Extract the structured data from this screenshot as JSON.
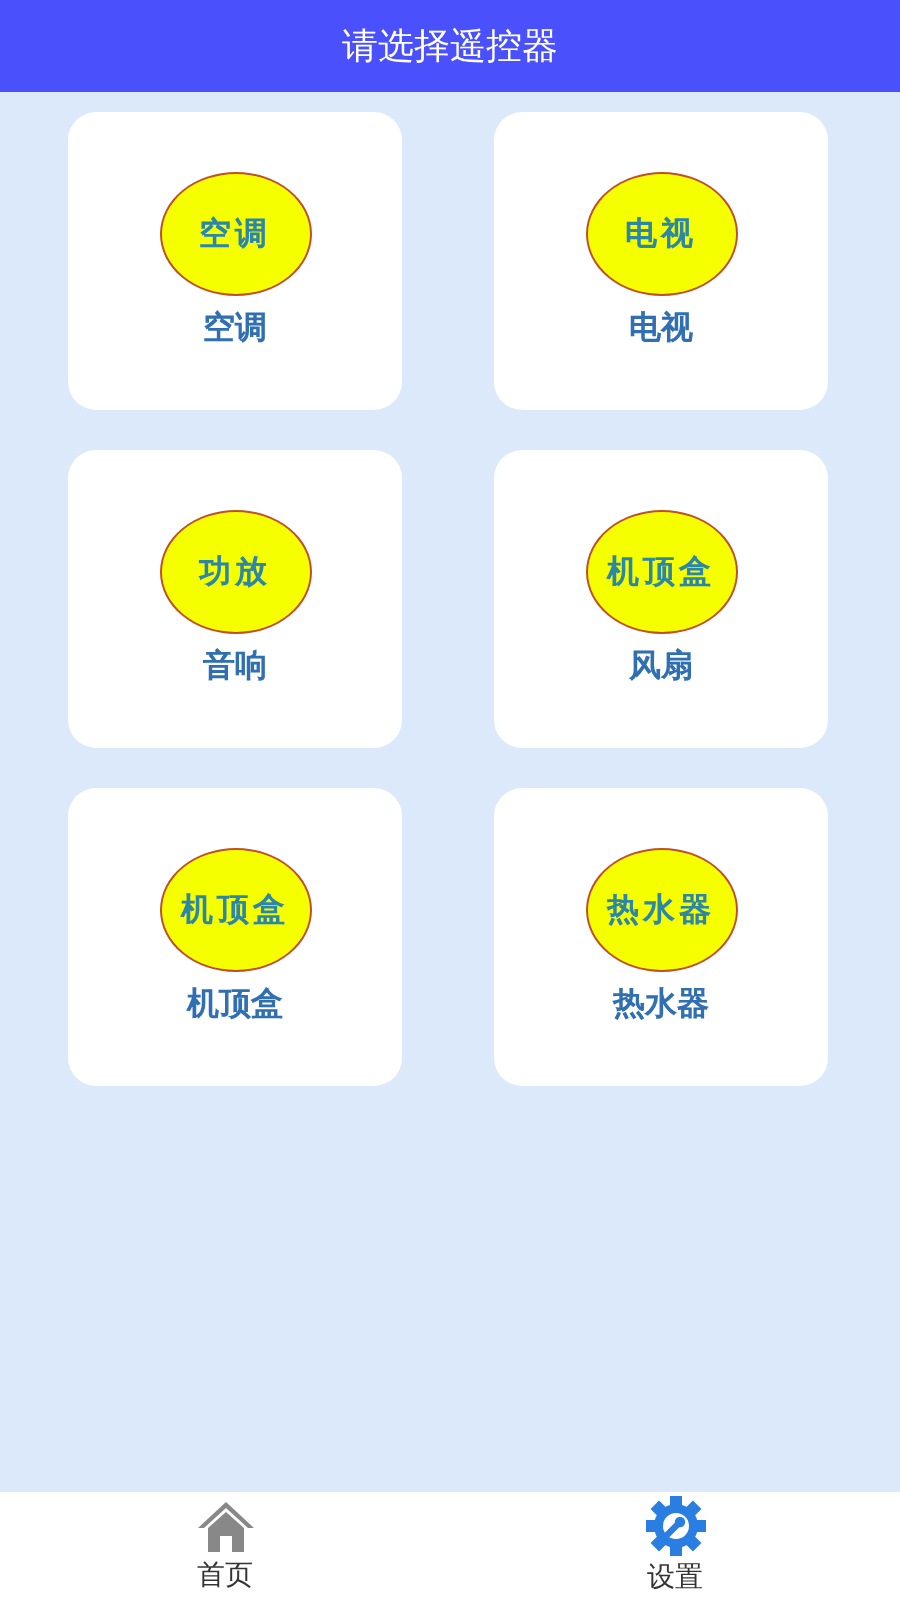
{
  "header": {
    "title": "请选择遥控器"
  },
  "devices": [
    {
      "badge": "空调",
      "label": "空调"
    },
    {
      "badge": "电视",
      "label": "电视"
    },
    {
      "badge": "功放",
      "label": "音响"
    },
    {
      "badge": "机顶盒",
      "label": "风扇"
    },
    {
      "badge": "机顶盒",
      "label": "机顶盒"
    },
    {
      "badge": "热水器",
      "label": "热水器"
    }
  ],
  "nav": [
    {
      "kind": "home",
      "label": "首页",
      "selected": false
    },
    {
      "kind": "settings",
      "label": "设置",
      "selected": true
    }
  ]
}
